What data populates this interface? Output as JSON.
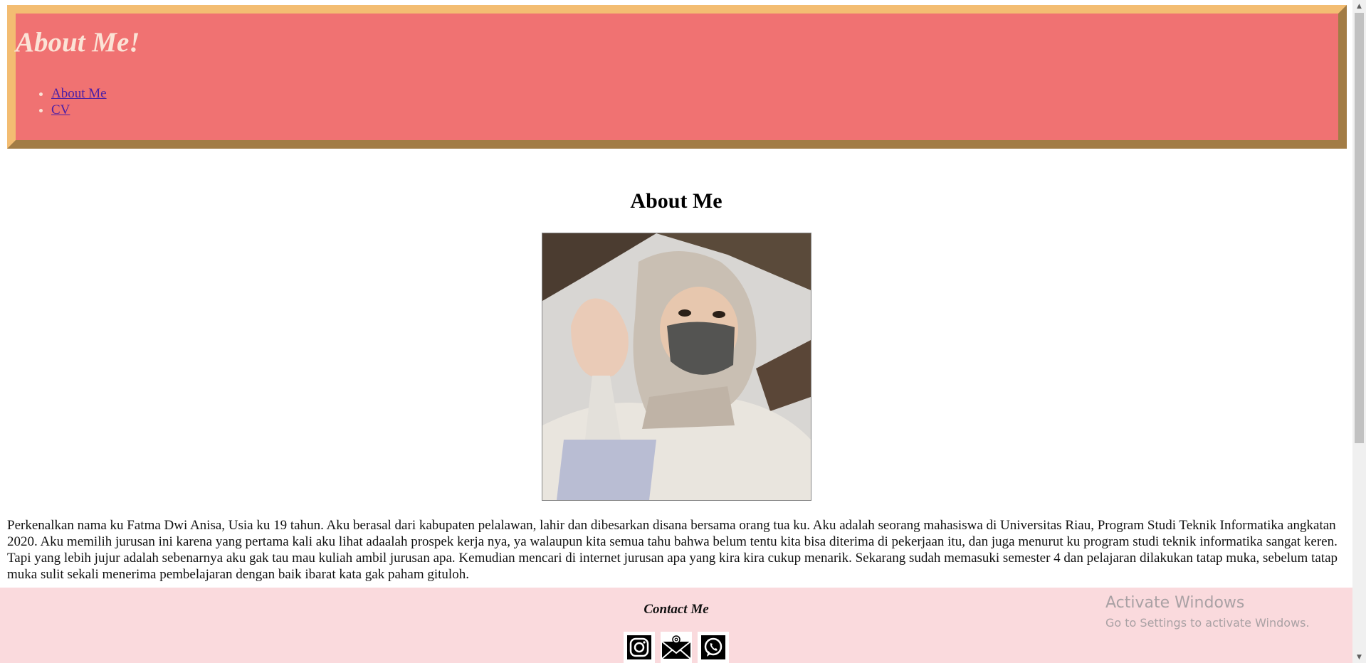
{
  "header": {
    "title": "About Me!",
    "nav": [
      {
        "label": "About Me"
      },
      {
        "label": "CV"
      }
    ]
  },
  "main": {
    "heading": "About Me",
    "photo_alt": "profile photo",
    "paragraph": "Perkenalkan nama ku Fatma Dwi Anisa, Usia ku 19 tahun. Aku berasal dari kabupaten pelalawan, lahir dan dibesarkan disana bersama orang tua ku. Aku adalah seorang mahasiswa di Universitas Riau, Program Studi Teknik Informatika angkatan 2020. Aku memilih jurusan ini karena yang pertama kali aku lihat adaalah prospek kerja nya, ya walaupun kita semua tahu bahwa belum tentu kita bisa diterima di pekerjaan itu, dan juga menurut ku program studi teknik informatika sangat keren. Tapi yang lebih jujur adalah sebenarnya aku gak tau mau kuliah ambil jurusan apa. Kemudian mencari di internet jurusan apa yang kira kira cukup menarik. Sekarang sudah memasuki semester 4 dan pelajaran dilakukan tatap muka, sebelum tatap muka sulit sekali menerima pembelajaran dengan baik ibarat kata gak paham gituloh."
  },
  "footer": {
    "contact_title": "Contact Me",
    "icons": [
      "instagram-icon",
      "email-icon",
      "whatsapp-icon"
    ]
  },
  "watermark": {
    "line1": "Activate Windows",
    "line2": "Go to Settings to activate Windows."
  },
  "colors": {
    "header_bg": "#f07272",
    "header_border_light": "#f3bd72",
    "header_border_dark": "#a27c45",
    "title_color": "#fbe3d6",
    "link_color": "#4b1fa6",
    "footer_bg": "#fadadd"
  }
}
